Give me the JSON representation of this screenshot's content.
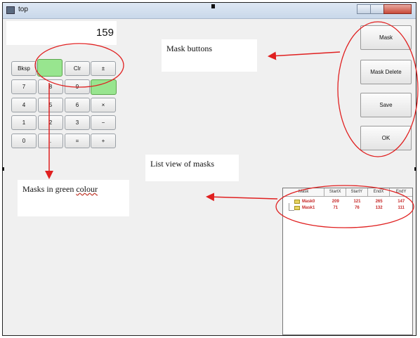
{
  "window": {
    "title": "top"
  },
  "calculator": {
    "display_value": "159",
    "keys": {
      "bksp": "Bksp",
      "clr": "Clr",
      "plus_minus": "±",
      "seven": "7",
      "eight": "8",
      "nine": "9",
      "four": "4",
      "five": "5",
      "six": "6",
      "times": "×",
      "one": "1",
      "two": "2",
      "three": "3",
      "minus": "−",
      "zero": "0",
      "dot": ".",
      "equals": "=",
      "plus": "+"
    }
  },
  "mask_panel": {
    "mask_label": "Mask",
    "mask_delete_label": "Mask Delete",
    "save_label": "Save",
    "ok_label": "OK"
  },
  "annotations": {
    "mask_buttons": "Mask buttons",
    "masks_green": "Masks in green ",
    "masks_green_last": "colour",
    "list_view": "List view of masks"
  },
  "list_view": {
    "columns": [
      "Mask",
      "StartX",
      "StartY",
      "EndX",
      "EndY"
    ],
    "rows": [
      {
        "name": "Mask0",
        "startx": "209",
        "starty": "121",
        "endx": "265",
        "endy": "147"
      },
      {
        "name": "Mask1",
        "startx": "71",
        "starty": "76",
        "endx": "132",
        "endy": "111"
      }
    ]
  },
  "colors": {
    "mask_green": "#98e58f",
    "annotation_red": "#e02020",
    "list_text_red": "#c62828"
  }
}
